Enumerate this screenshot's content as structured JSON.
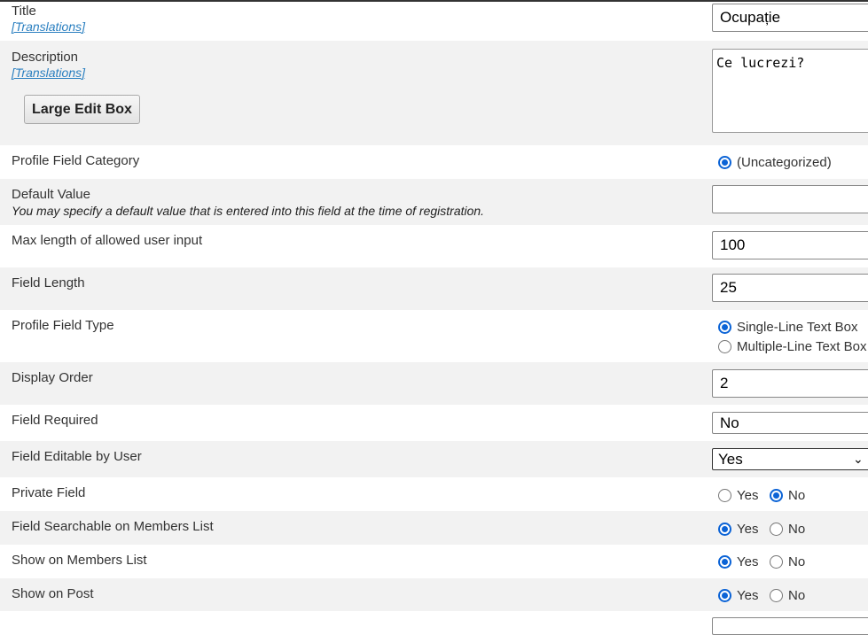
{
  "fields": {
    "title": {
      "label": "Title",
      "translations": "[Translations]",
      "value": "Ocupație"
    },
    "description": {
      "label": "Description",
      "translations": "[Translations]",
      "value": "Ce lucrezi?",
      "large_edit_button": "Large Edit Box"
    },
    "category": {
      "label": "Profile Field Category",
      "option": "(Uncategorized)"
    },
    "default_value": {
      "label": "Default Value",
      "hint": "You may specify a default value that is entered into this field at the time of registration.",
      "value": ""
    },
    "max_length": {
      "label": "Max length of allowed user input",
      "value": "100"
    },
    "field_length": {
      "label": "Field Length",
      "value": "25"
    },
    "field_type": {
      "label": "Profile Field Type",
      "options": [
        "Single-Line Text Box",
        "Multiple-Line Text Box"
      ],
      "selected": "Single-Line Text Box"
    },
    "display_order": {
      "label": "Display Order",
      "value": "2"
    },
    "required": {
      "label": "Field Required",
      "value": "No"
    },
    "editable": {
      "label": "Field Editable by User",
      "value": "Yes"
    },
    "private": {
      "label": "Private Field",
      "yes": "Yes",
      "no": "No",
      "selected": "No"
    },
    "searchable": {
      "label": "Field Searchable on Members List",
      "yes": "Yes",
      "no": "No",
      "selected": "Yes"
    },
    "members_list": {
      "label": "Show on Members List",
      "yes": "Yes",
      "no": "No",
      "selected": "Yes"
    },
    "show_on_post": {
      "label": "Show on Post",
      "yes": "Yes",
      "no": "No",
      "selected": "Yes"
    }
  },
  "colors": {
    "radio_selected": "#0b63d6",
    "link": "#2a7fc0",
    "row_alt": "#f2f2f2"
  }
}
